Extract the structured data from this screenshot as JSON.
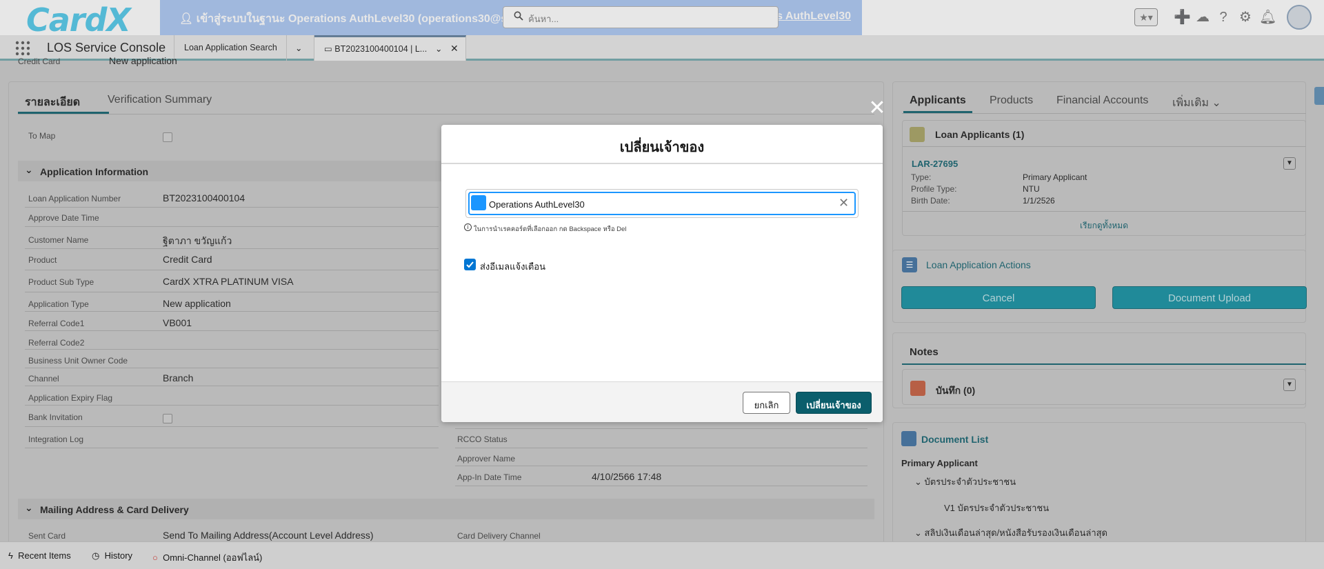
{
  "header": {
    "logo": "CardX",
    "impersonation_text": "เข้าสู่ระบบในฐานะ Operations AuthLevel30 (operations30@scb.ca",
    "impersonation_right": "ns AuthLevel30",
    "search_placeholder": "ค้นหา..."
  },
  "nav": {
    "app_name": "LOS Service Console",
    "tabs": [
      {
        "label": "Loan Application Search"
      },
      {
        "label": "BT2023100400104 | L..."
      }
    ]
  },
  "top_partial": {
    "label": "Credit Card",
    "value": "New application"
  },
  "left_panel": {
    "tabs": [
      "รายละเอียด",
      "Verification Summary"
    ],
    "to_map_label": "To Map",
    "section_app_info": "Application Information",
    "fields": [
      {
        "label": "Loan Application Number",
        "value": "BT2023100400104"
      },
      {
        "label": "Approve Date Time",
        "value": ""
      },
      {
        "label": "Customer Name",
        "value": "ฐิตาภา ขวัญแก้ว"
      },
      {
        "label": "Product",
        "value": "Credit Card"
      },
      {
        "label": "Product Sub Type",
        "value": "CardX XTRA PLATINUM VISA"
      },
      {
        "label": "Application Type",
        "value": "New application"
      },
      {
        "label": "Referral Code1",
        "value": "VB001"
      },
      {
        "label": "Referral Code2",
        "value": ""
      },
      {
        "label": "Business Unit Owner Code",
        "value": ""
      },
      {
        "label": "Channel",
        "value": "Branch"
      },
      {
        "label": "Application Expiry Flag",
        "value": ""
      },
      {
        "label": "Bank Invitation",
        "value": ""
      },
      {
        "label": "Integration Log",
        "value": ""
      }
    ],
    "right_fields": [
      {
        "label": "RCCO Status",
        "value": ""
      },
      {
        "label": "Approver Name",
        "value": ""
      },
      {
        "label": "App-In Date Time",
        "value": "4/10/2566 17:48"
      }
    ],
    "section_mailing": "Mailing Address & Card Delivery",
    "sent_card_label": "Sent Card",
    "sent_card_value": "Send To Mailing Address(Account Level Address)",
    "card_delivery_label": "Card Delivery Channel"
  },
  "right_panel": {
    "tabs": [
      "Applicants",
      "Products",
      "Financial Accounts",
      "เพิ่มเติม"
    ],
    "loan_applicants_title": "Loan Applicants (1)",
    "applicant": {
      "id": "LAR-27695",
      "rows": [
        {
          "label": "Type:",
          "value": "Primary Applicant"
        },
        {
          "label": "Profile Type:",
          "value": "NTU"
        },
        {
          "label": "Birth Date:",
          "value": "1/1/2526"
        }
      ]
    },
    "view_all": "เรียกดูทั้งหมด",
    "actions_title": "Loan Application Actions",
    "action_buttons": [
      "Cancel",
      "Document Upload"
    ],
    "notes_tab": "Notes",
    "notes_item": "บันทึก (0)",
    "doc_list_title": "Document List",
    "doc_primary": "Primary Applicant",
    "doc_items": [
      "บัตรประจำตัวประชาชน",
      "V1 บัตรประจำตัวประชาชน",
      "สลิปเงินเดือนล่าสุด/หนังสือรับรองเงินเดือนล่าสุด"
    ]
  },
  "modal": {
    "title": "เปลี่ยนเจ้าของ",
    "owner_name": "Operations AuthLevel30",
    "hint": "ในการนำเรคคอร์ดที่เลือกออก กด Backspace หรือ Del",
    "notify_label": "ส่งอีเมลแจ้งเตือน",
    "notify_checked": true,
    "cancel_label": "ยกเลิก",
    "submit_label": "เปลี่ยนเจ้าของ"
  },
  "utility_bar": {
    "items": [
      "Recent Items",
      "History",
      "Omni-Channel (ออฟไลน์)"
    ]
  }
}
